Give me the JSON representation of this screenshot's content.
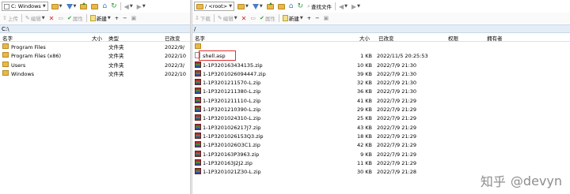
{
  "left": {
    "drive_label": "C: Windows",
    "toolbar": {
      "upload": "上传",
      "edit": "编辑",
      "properties": "属性",
      "new": "新建"
    },
    "path": "C:\\",
    "columns": {
      "name": "名字",
      "size": "大小",
      "type": "类型",
      "modified": "已改变"
    },
    "rows": [
      {
        "name": "Program Files",
        "size": "",
        "type": "文件夹",
        "modified": "2022/9/"
      },
      {
        "name": "Program Files (x86)",
        "size": "",
        "type": "文件夹",
        "modified": "2022/10"
      },
      {
        "name": "Users",
        "size": "",
        "type": "文件夹",
        "modified": "2022/3/"
      },
      {
        "name": "Windows",
        "size": "",
        "type": "文件夹",
        "modified": "2022/10"
      }
    ]
  },
  "right": {
    "drive_label": "/ <root>",
    "toolbar": {
      "download": "下载",
      "edit": "编辑",
      "properties": "属性",
      "new": "新建",
      "find": "查找文件"
    },
    "path": "/",
    "columns": {
      "name": "名字",
      "size": "大小",
      "modified": "已改变",
      "perms": "权限",
      "owner": "拥有者"
    },
    "rows": [
      {
        "name": "..",
        "size": "",
        "modified": "",
        "icon": "parent"
      },
      {
        "name": "shell.asp",
        "size": "1 KB",
        "modified": "2022/11/5 20:25:53",
        "icon": "asp"
      },
      {
        "name": "1-1P320163434135.zip",
        "size": "10 KB",
        "modified": "2022/7/9 21:30",
        "icon": "zip"
      },
      {
        "name": "1-1P3201026094447.zip",
        "size": "39 KB",
        "modified": "2022/7/9 21:30",
        "icon": "zip"
      },
      {
        "name": "1-1P3201211570-L.zip",
        "size": "32 KB",
        "modified": "2022/7/9 21:30",
        "icon": "zip"
      },
      {
        "name": "1-1P3201211380-L.zip",
        "size": "36 KB",
        "modified": "2022/7/9 21:30",
        "icon": "zip"
      },
      {
        "name": "1-1P3201211110-L.zip",
        "size": "41 KB",
        "modified": "2022/7/9 21:29",
        "icon": "zip"
      },
      {
        "name": "1-1P3201210390-L.zip",
        "size": "29 KB",
        "modified": "2022/7/9 21:29",
        "icon": "zip"
      },
      {
        "name": "1-1P3201024310-L.zip",
        "size": "25 KB",
        "modified": "2022/7/9 21:29",
        "icon": "zip"
      },
      {
        "name": "1-1P3201026217J7.zip",
        "size": "43 KB",
        "modified": "2022/7/9 21:29",
        "icon": "zip"
      },
      {
        "name": "1-1P3201026153Q3.zip",
        "size": "18 KB",
        "modified": "2022/7/9 21:29",
        "icon": "zip"
      },
      {
        "name": "1-1P3201026O3C1.zip",
        "size": "42 KB",
        "modified": "2022/7/9 21:29",
        "icon": "zip"
      },
      {
        "name": "1-1P320163P3963.zip",
        "size": "9 KB",
        "modified": "2022/7/9 21:29",
        "icon": "zip"
      },
      {
        "name": "1-1P320163J2J2.zip",
        "size": "11 KB",
        "modified": "2022/7/9 21:29",
        "icon": "zip"
      },
      {
        "name": "1-1P3201021Z30-L.zip",
        "size": "30 KB",
        "modified": "2022/7/9 21:28",
        "icon": "zip"
      }
    ]
  },
  "watermark": {
    "logo": "知乎",
    "handle": "@devyn"
  },
  "colors": {
    "path_bg": "#e3edf8",
    "highlight": "#e03030",
    "folder": "#e8b84a"
  }
}
